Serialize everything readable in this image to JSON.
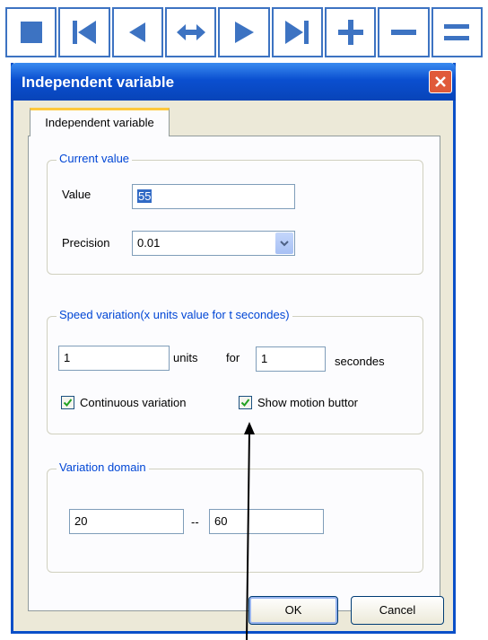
{
  "toolbar": {
    "buttons": [
      {
        "name": "stop-icon"
      },
      {
        "name": "skip-to-start-icon"
      },
      {
        "name": "step-back-icon"
      },
      {
        "name": "back-and-forth-icon"
      },
      {
        "name": "play-icon"
      },
      {
        "name": "skip-to-end-icon"
      },
      {
        "name": "plus-icon"
      },
      {
        "name": "minus-icon"
      },
      {
        "name": "equals-icon"
      }
    ],
    "accent": "#3d73c2"
  },
  "dialog": {
    "title": "Independent variable",
    "tab_label": "Independent variable",
    "current_value": {
      "legend": "Current value",
      "value_label": "Value",
      "value": "55",
      "precision_label": "Precision",
      "precision": "0.01"
    },
    "speed_variation": {
      "legend": "Speed variation(x units value for t secondes)",
      "units_value": "1",
      "units_label": "units",
      "for_label": "for",
      "seconds_value": "1",
      "seconds_label": "secondes",
      "continuous_label": "Continuous variation",
      "continuous_checked": true,
      "motion_label": "Show motion buttor",
      "motion_checked": true
    },
    "variation_domain": {
      "legend": "Variation domain",
      "min": "20",
      "separator": "--",
      "max": "60"
    },
    "ok_label": "OK",
    "cancel_label": "Cancel"
  }
}
